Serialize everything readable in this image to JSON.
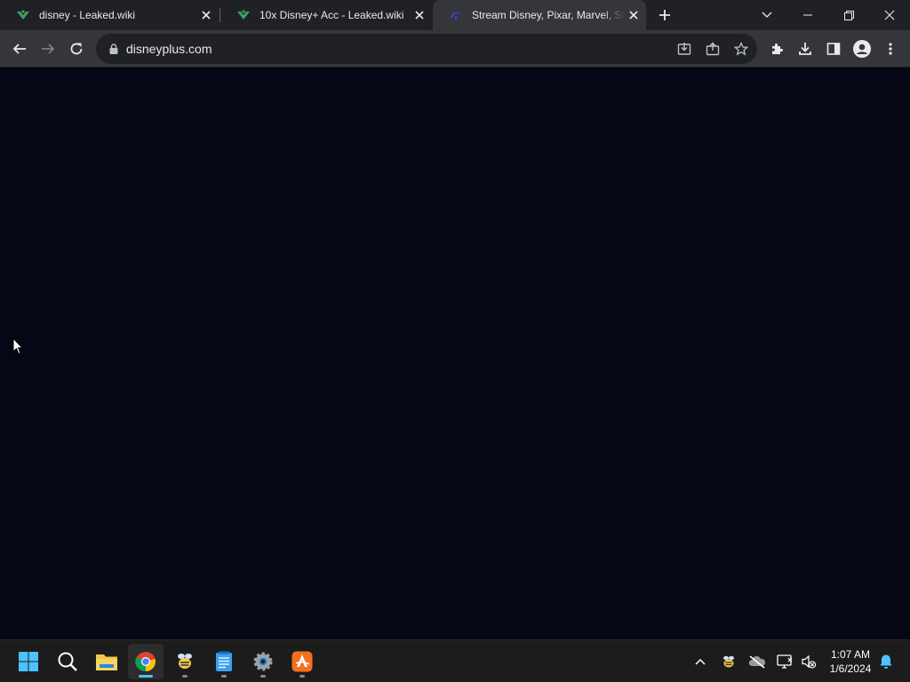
{
  "browser": {
    "tabs": [
      {
        "title": "disney - Leaked.wiki",
        "favicon": "leaked-wiki-icon",
        "active": false
      },
      {
        "title": "10x Disney+ Acc - Leaked.wiki",
        "favicon": "leaked-wiki-icon",
        "active": false
      },
      {
        "title": "Stream Disney, Pixar, Marvel, Star Wars, Nat Geo",
        "favicon": "disney-plus-icon",
        "active": true
      }
    ],
    "address": "disneyplus.com"
  },
  "taskbar": {
    "time": "1:07 AM",
    "date": "1/6/2024"
  },
  "colors": {
    "page_background": "#040714",
    "tab_strip": "#202124",
    "toolbar": "#35363a",
    "taskbar": "#1c1c1c",
    "accent": "#4cc2ff"
  }
}
